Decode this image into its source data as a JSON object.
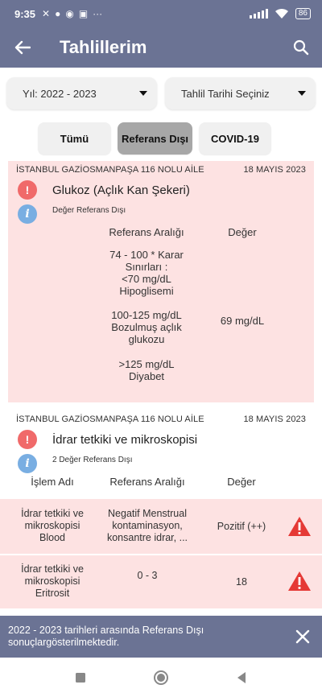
{
  "status": {
    "time": "9:35",
    "battery": "86",
    "dots": "···"
  },
  "appbar": {
    "title": "Tahlillerim"
  },
  "filters": {
    "year": "Yıl: 2022 - 2023",
    "date": "Tahlil Tarihi Seçiniz"
  },
  "tabs": [
    {
      "label": "Tümü",
      "active": false
    },
    {
      "label": "Referans Dışı",
      "active": true
    },
    {
      "label": "COVID-19",
      "active": false
    }
  ],
  "results": [
    {
      "institution": "İSTANBUL GAZİOSMANPAŞA 116 NOLU AİLE",
      "date": "18 MAYIS 2023",
      "test": "Glukoz (Açlık Kan Şekeri)",
      "note": "Değer Referans Dışı",
      "headers": {
        "ref": "Referans Aralığı",
        "value": "Değer"
      },
      "ref_lines_1": [
        "74 - 100 * Karar",
        "Sınırları :",
        "<70 mg/dL",
        "Hipoglisemi"
      ],
      "ref_lines_2": [
        "100-125 mg/dL",
        "Bozulmuş açlık",
        "glukozu"
      ],
      "ref_lines_3": [
        ">125 mg/dL",
        "Diyabet"
      ],
      "value": "69 mg/dL"
    },
    {
      "institution": "İSTANBUL GAZİOSMANPAŞA 116 NOLU AİLE",
      "date": "18 MAYIS 2023",
      "test": "İdrar tetkiki ve mikroskopisi",
      "note": "2 Değer Referans Dışı",
      "headers": {
        "name": "İşlem Adı",
        "ref": "Referans Aralığı",
        "value": "Değer"
      },
      "rows": [
        {
          "name": [
            "İdrar tetkiki ve",
            "mikroskopisi",
            "Blood"
          ],
          "ref": [
            "Negatif Menstrual",
            "kontaminasyon,",
            "konsantre idrar, ..."
          ],
          "value": "Pozitif (++)"
        },
        {
          "name": [
            "İdrar tetkiki ve",
            "mikroskopisi",
            "Eritrosit"
          ],
          "ref": [
            "0 - 3"
          ],
          "value": "18"
        }
      ]
    }
  ],
  "snackbar": {
    "message": "2022 - 2023 tarihleri arasında Referans Dışı sonuçlargösterilmektedir."
  }
}
